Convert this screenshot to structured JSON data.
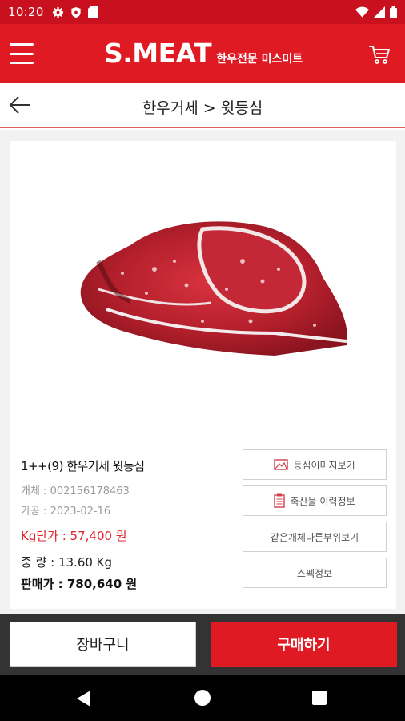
{
  "status_bar": {
    "time": "10:20",
    "icons": [
      "gear-icon",
      "shield-icon",
      "sd-card-icon",
      "wifi-icon",
      "signal-icon",
      "battery-icon"
    ]
  },
  "app_bar": {
    "brand": "S.MEAT",
    "tagline": "한우전문 미스미트",
    "colors": {
      "primary": "#e01a22",
      "status": "#c8101e"
    }
  },
  "title_bar": {
    "title": "한우거세 > 윗등심"
  },
  "product": {
    "name": "1++(9) 한우거세 윗등심",
    "individual": "개체 : 002156178463",
    "processed": "가공 : 2023-02-16",
    "unit_price": "Kg단가 : 57,400 원",
    "weight": "중  량 : 13.60 Kg",
    "sale_price": "판매가 : 780,640 원"
  },
  "side_buttons": {
    "grade_image": "등심이미지보기",
    "livestock_history": "축산물 이력정보",
    "same_entity": "같은개체다른부위보기",
    "spec_info": "스펙정보"
  },
  "bottom_buttons": {
    "cart": "장바구니",
    "buy": "구매하기"
  }
}
